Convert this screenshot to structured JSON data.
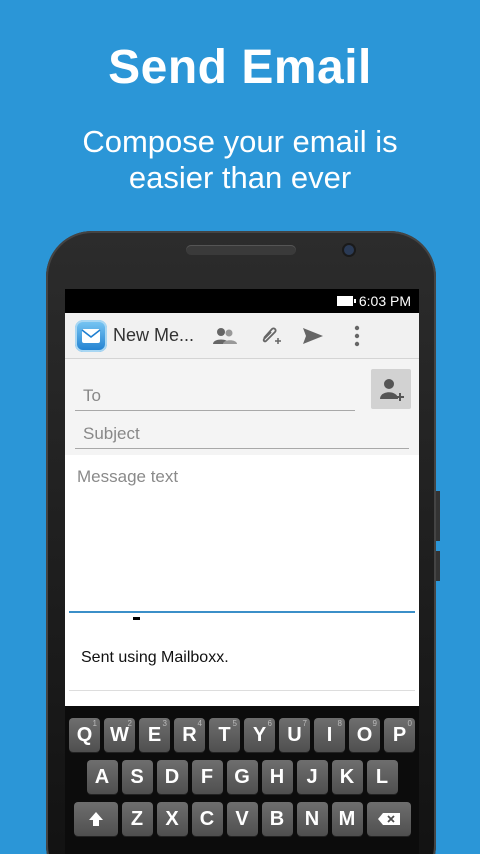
{
  "promo": {
    "title": "Send Email",
    "subtitle_line1": "Compose your email is",
    "subtitle_line2": "easier than ever"
  },
  "status_bar": {
    "time": "6:03 PM"
  },
  "action_bar": {
    "title": "New Me...",
    "icons": [
      "app-mail-icon",
      "contacts-icon",
      "attach-icon",
      "send-icon",
      "overflow-menu-icon"
    ]
  },
  "compose": {
    "to_placeholder": "To",
    "subject_placeholder": "Subject",
    "message_placeholder": "Message text",
    "signature": "Sent using Mailboxx."
  },
  "keyboard": {
    "row1": [
      {
        "key": "Q",
        "alt": "1"
      },
      {
        "key": "W",
        "alt": "2"
      },
      {
        "key": "E",
        "alt": "3"
      },
      {
        "key": "R",
        "alt": "4"
      },
      {
        "key": "T",
        "alt": "5"
      },
      {
        "key": "Y",
        "alt": "6"
      },
      {
        "key": "U",
        "alt": "7"
      },
      {
        "key": "I",
        "alt": "8"
      },
      {
        "key": "O",
        "alt": "9"
      },
      {
        "key": "P",
        "alt": "0"
      }
    ],
    "row2": [
      "A",
      "S",
      "D",
      "F",
      "G",
      "H",
      "J",
      "K",
      "L"
    ],
    "row3": [
      "Z",
      "X",
      "C",
      "V",
      "B",
      "N",
      "M"
    ]
  },
  "colors": {
    "background": "#2b96d7",
    "accent": "#3b8fc8"
  }
}
